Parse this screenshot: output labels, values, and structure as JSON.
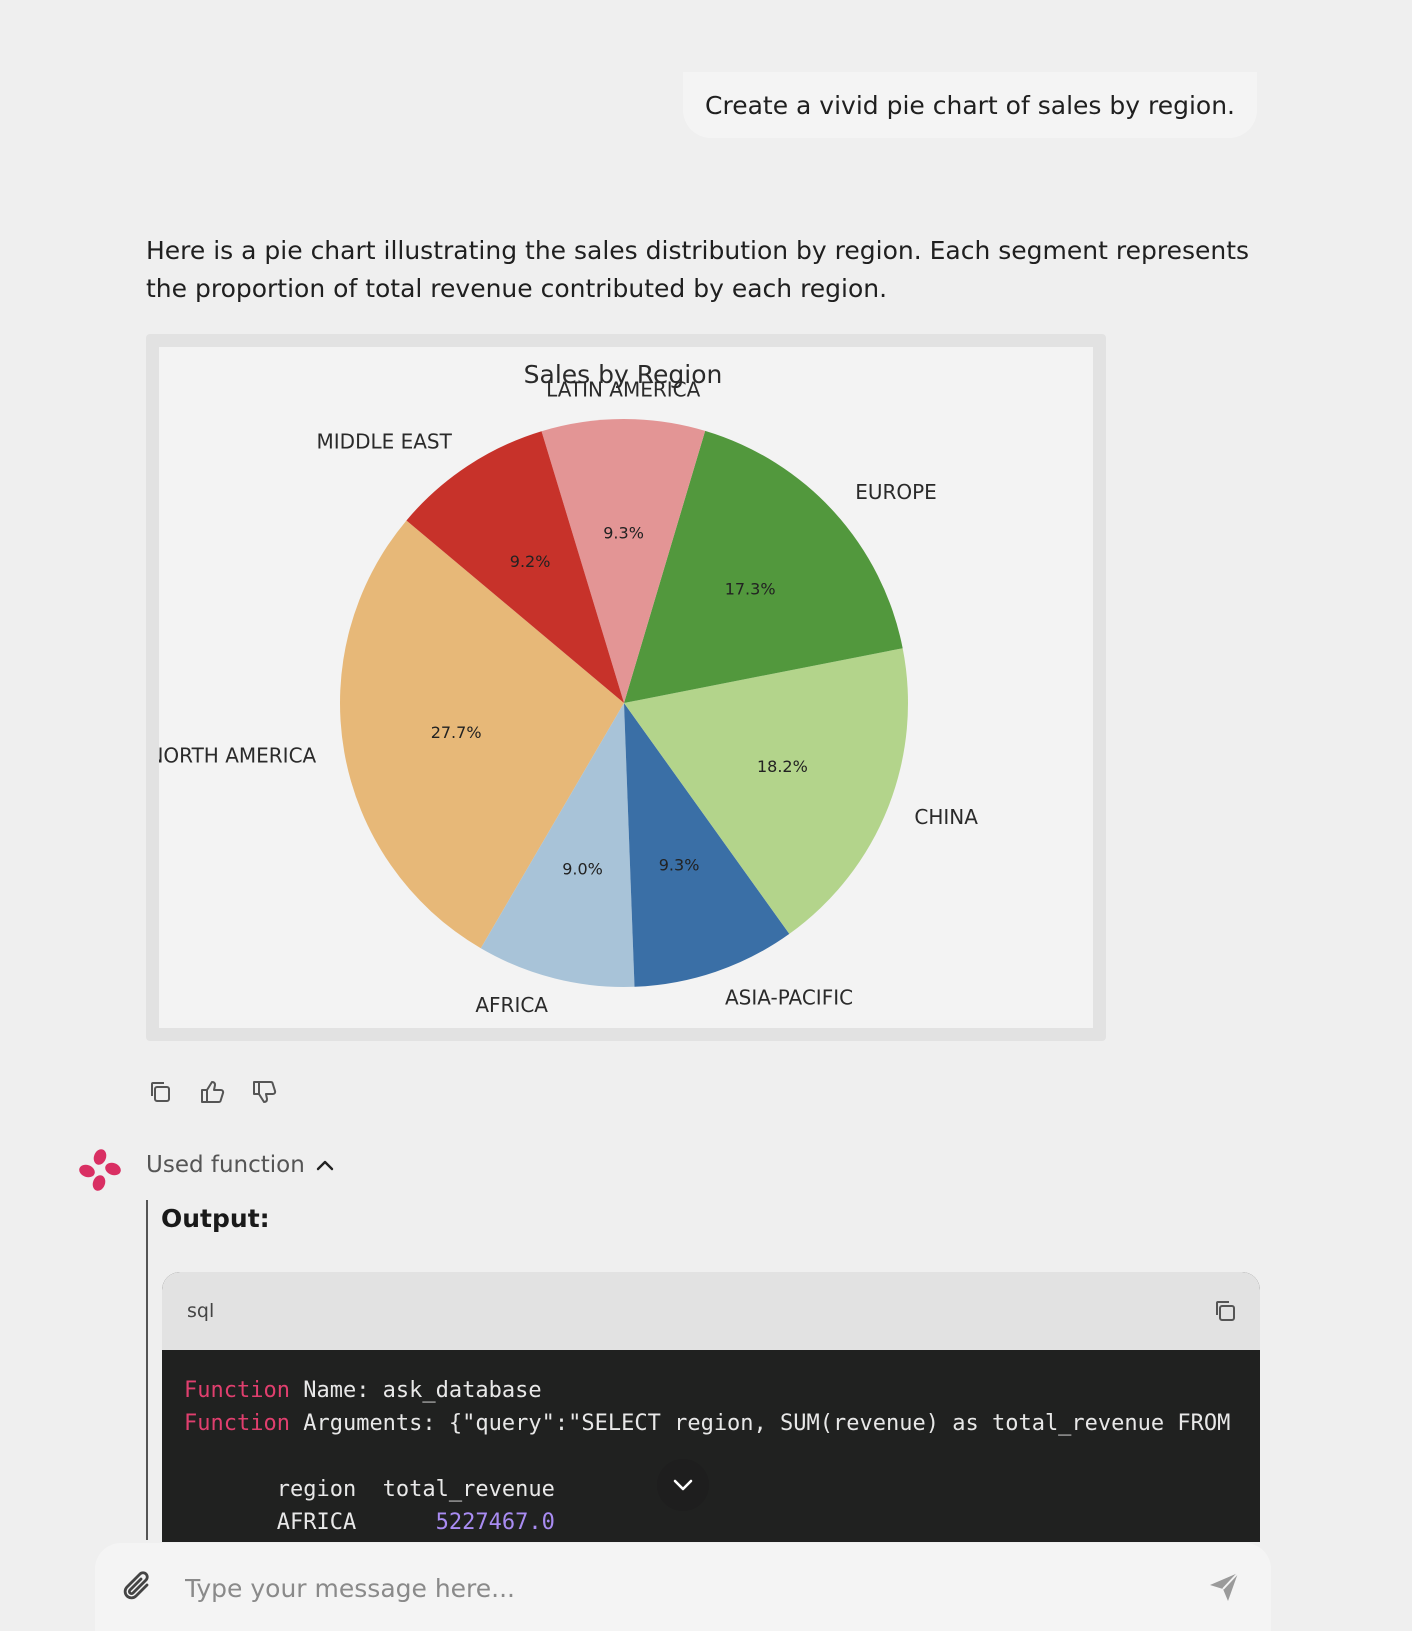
{
  "user_message": "Create a vivid pie chart of sales by region.",
  "assistant_message": "Here is a pie chart illustrating the sales distribution by region. Each segment represents the proportion of total revenue contributed by each region.",
  "chart_data": {
    "type": "pie",
    "title": "Sales by Region",
    "start_angle_deg": 140,
    "direction": "counterclockwise",
    "slices": [
      {
        "label": "NORTH AMERICA",
        "value": 27.7,
        "pct": "27.7%",
        "color": "#e7b878"
      },
      {
        "label": "AFRICA",
        "value": 9.0,
        "pct": "9.0%",
        "color": "#a8c3d8"
      },
      {
        "label": "ASIA-PACIFIC",
        "value": 9.3,
        "pct": "9.3%",
        "color": "#3a6fa6"
      },
      {
        "label": "CHINA",
        "value": 18.2,
        "pct": "18.2%",
        "color": "#b3d48b"
      },
      {
        "label": "EUROPE",
        "value": 17.3,
        "pct": "17.3%",
        "color": "#52983d"
      },
      {
        "label": "LATIN AMERICA",
        "value": 9.3,
        "pct": "9.3%",
        "color": "#e39595"
      },
      {
        "label": "MIDDLE EAST",
        "value": 9.2,
        "pct": "9.2%",
        "color": "#c7322a"
      }
    ]
  },
  "actions": {
    "copy_icon": "copy-icon",
    "like_icon": "thumbs-up-icon",
    "dislike_icon": "thumbs-down-icon"
  },
  "function_call": {
    "toggle_label": "Used function",
    "output_label": "Output:",
    "language": "sql",
    "line1_kw": "Function",
    "line1_rest": " Name: ask_database",
    "line2_kw": "Function",
    "line2_rest": " Arguments: {\"query\":\"SELECT region, SUM(revenue) as total_revenue FROM",
    "table_header": "       region  total_revenue",
    "row1_region": "       AFRICA      ",
    "row1_value": "5227467.0"
  },
  "composer": {
    "placeholder": "Type your message here..."
  },
  "colors": {
    "background": "#efefef",
    "code_background": "#202120",
    "keyword": "#e03f6e",
    "number": "#a98cf2",
    "avatar": "#d92f63"
  }
}
